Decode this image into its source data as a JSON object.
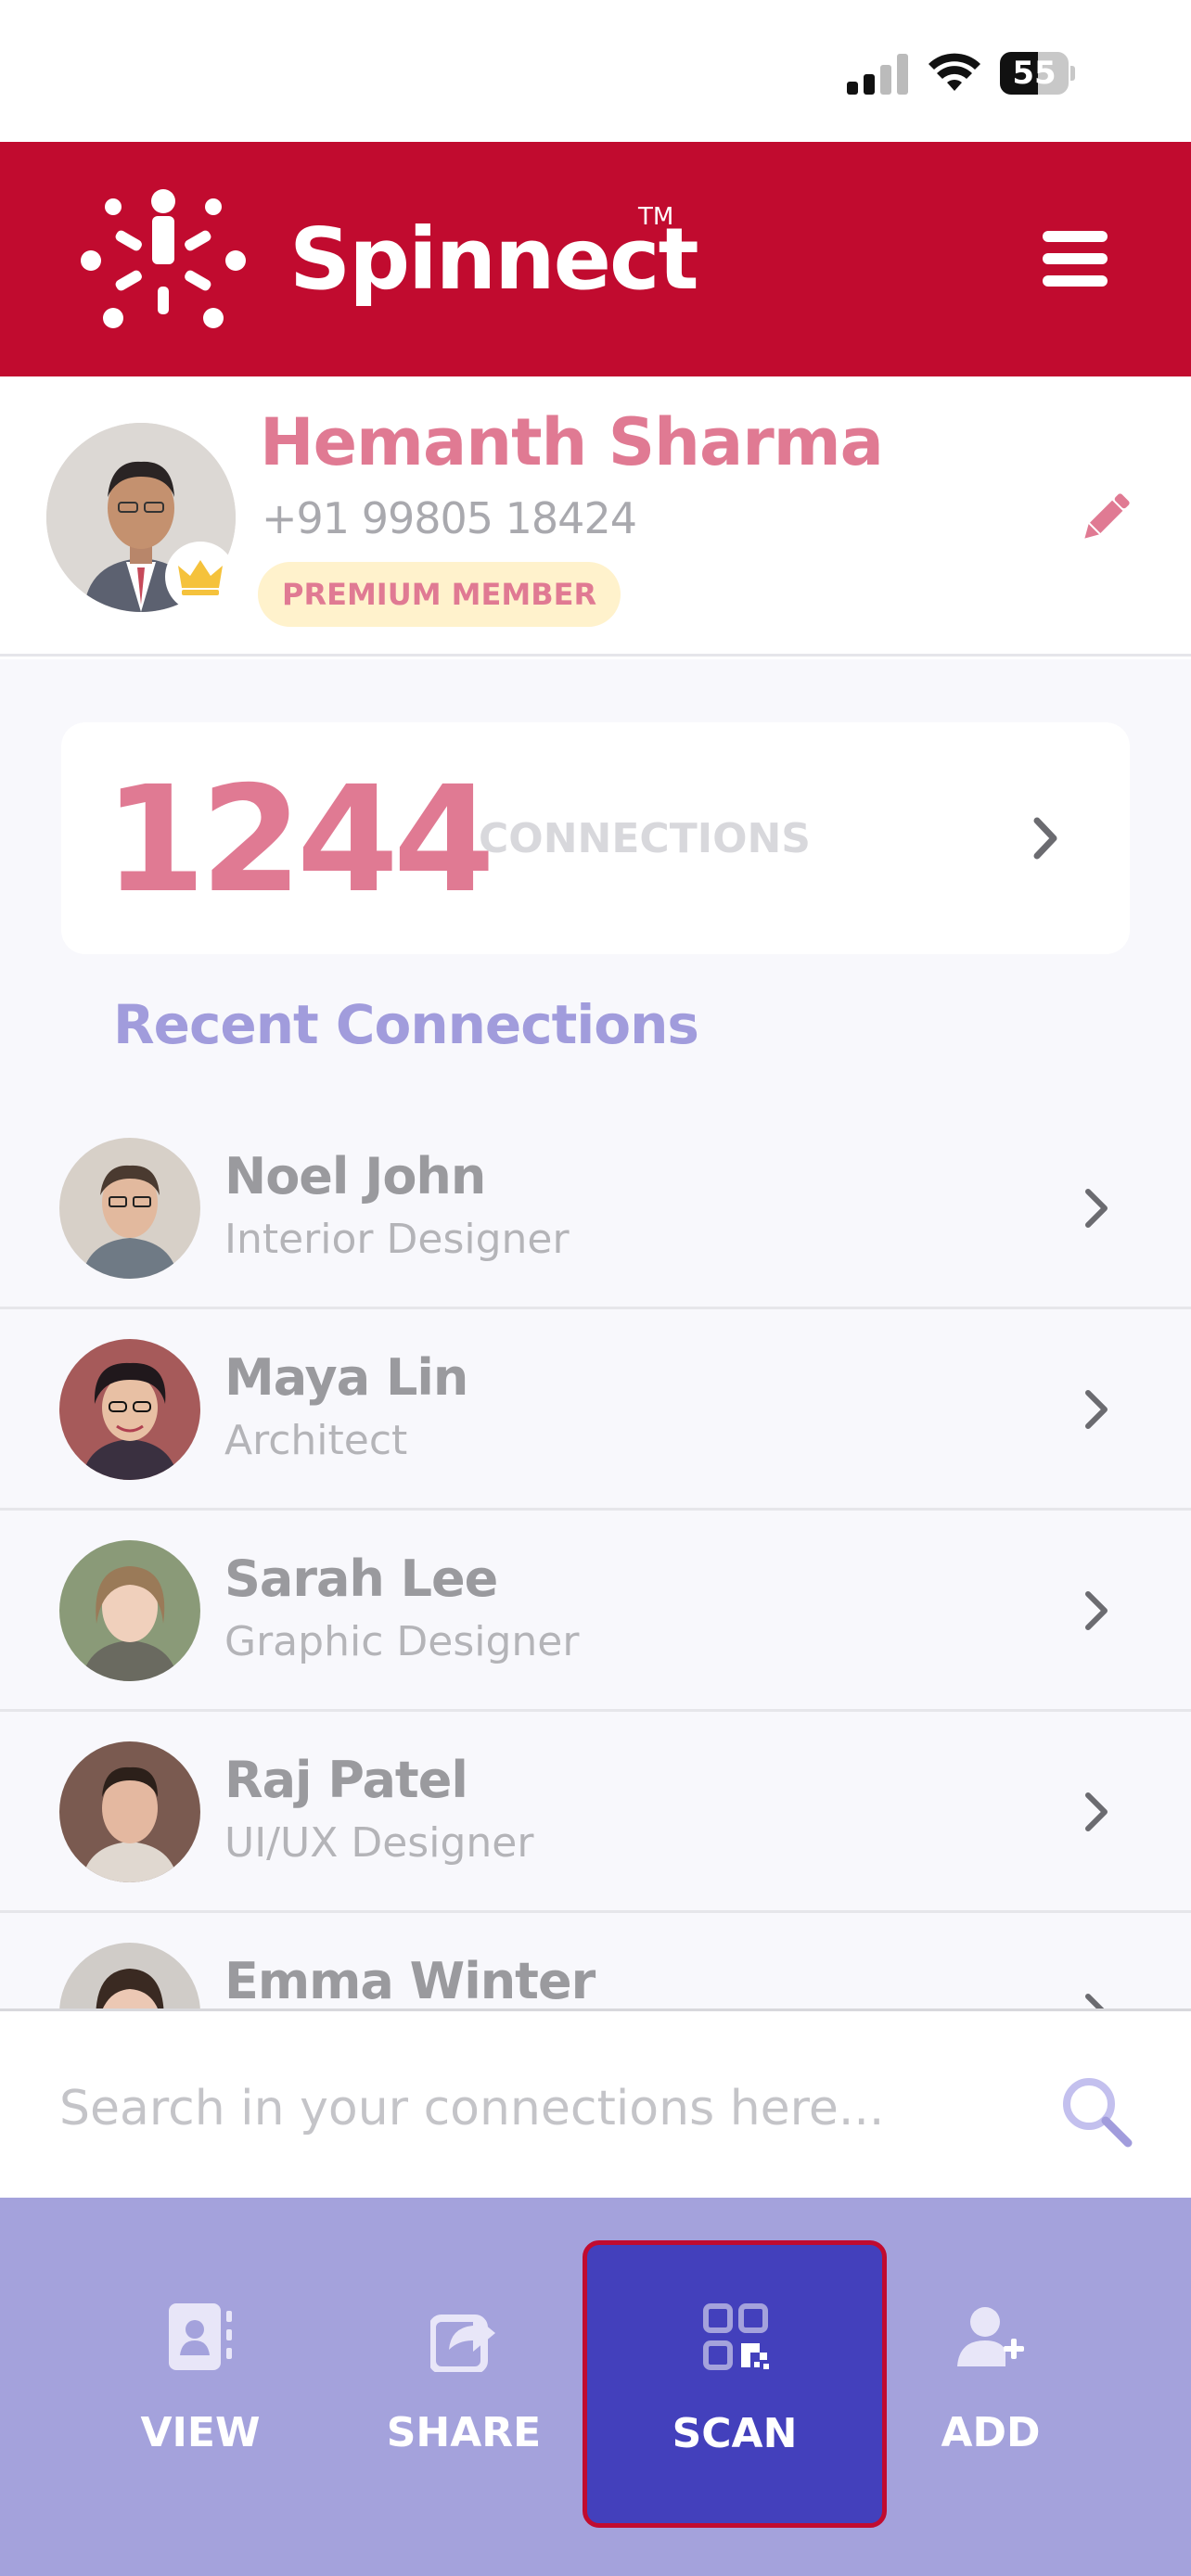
{
  "status_bar": {
    "battery_percent": "55",
    "battery_level": 0.55
  },
  "header": {
    "brand_name": "Spinnect",
    "trademark": "TM",
    "brand_color": "#c10b2f"
  },
  "profile": {
    "name": "Hemanth Sharma",
    "phone": "+91 99805 18424",
    "badge": "PREMIUM MEMBER"
  },
  "connections": {
    "count": "1244",
    "label": "CONNECTIONS"
  },
  "recent": {
    "title": "Recent Connections",
    "items": [
      {
        "name": "Noel John",
        "role": "Interior Designer"
      },
      {
        "name": "Maya Lin",
        "role": "Architect"
      },
      {
        "name": "Sarah Lee",
        "role": "Graphic Designer"
      },
      {
        "name": "Raj Patel",
        "role": "UI/UX Designer"
      },
      {
        "name": "Emma Winter",
        "role": ""
      }
    ]
  },
  "search": {
    "placeholder": "Search in your connections here..."
  },
  "bottom_nav": {
    "items": [
      {
        "label": "VIEW",
        "icon": "contact-card-icon"
      },
      {
        "label": "SHARE",
        "icon": "share-icon"
      },
      {
        "label": "SCAN",
        "icon": "qr-code-icon",
        "active": true
      },
      {
        "label": "ADD",
        "icon": "add-user-icon"
      }
    ],
    "bar_color": "#a4a2dc",
    "active_color": "#4340bc"
  }
}
